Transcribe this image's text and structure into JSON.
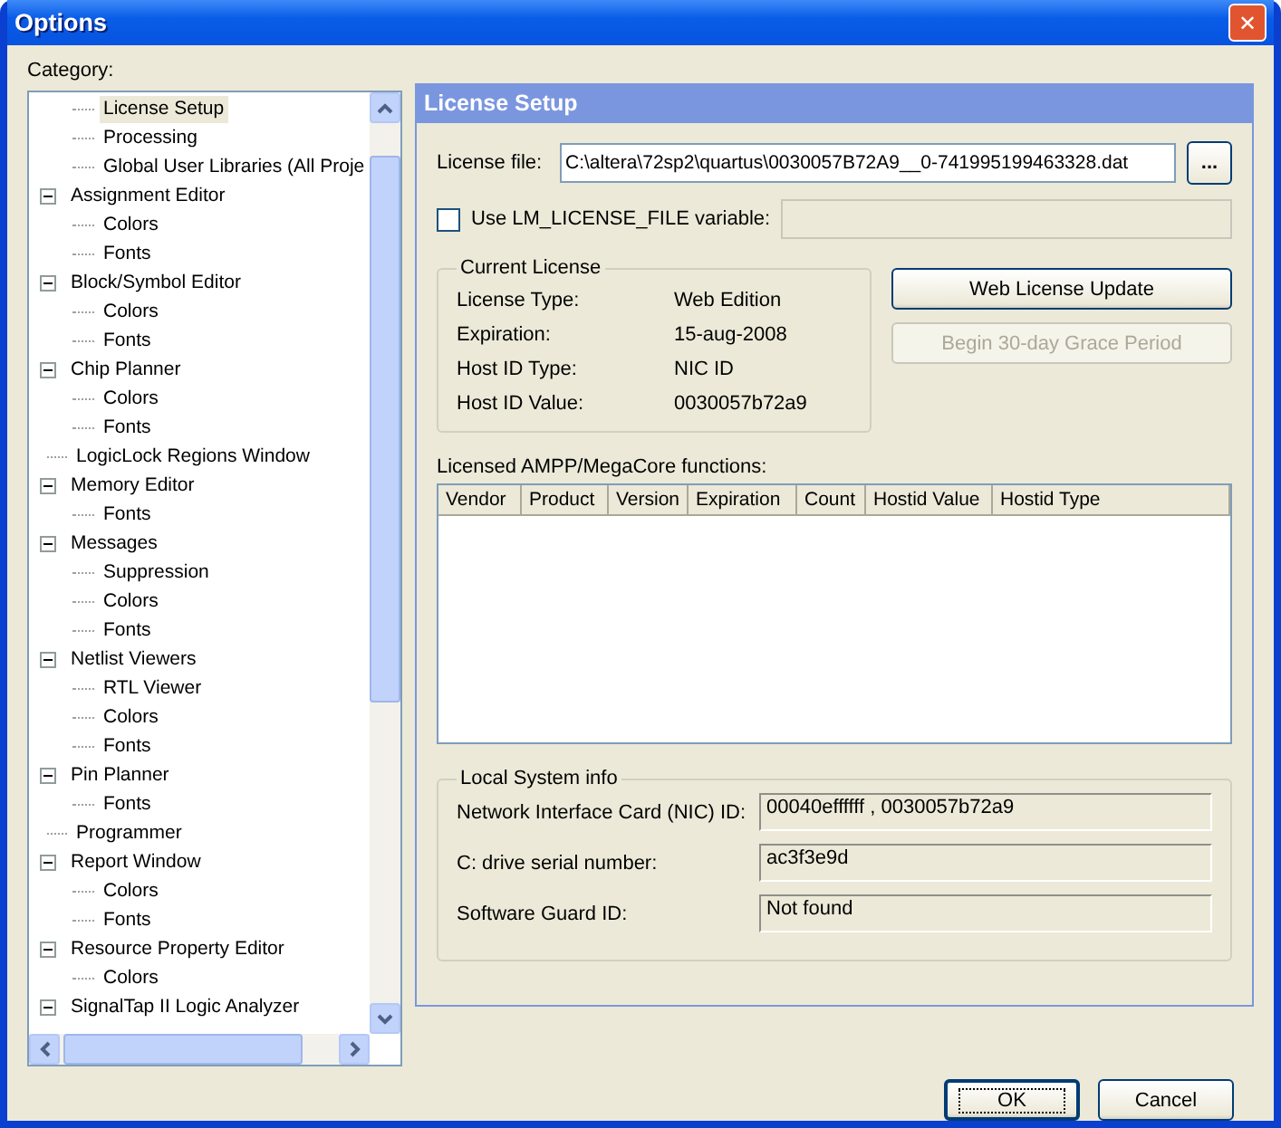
{
  "window": {
    "title": "Options",
    "close_label": "✕"
  },
  "category_label": "Category:",
  "tree": {
    "continued_children": [
      {
        "label": "License Setup",
        "selected": true
      },
      {
        "label": "Processing",
        "selected": false
      },
      {
        "label": "Global User Libraries (All Proje",
        "selected": false
      }
    ],
    "items": [
      {
        "label": "Assignment Editor",
        "selected": false,
        "expanded": true,
        "children": [
          {
            "label": "Colors",
            "selected": false
          },
          {
            "label": "Fonts",
            "selected": false
          }
        ]
      },
      {
        "label": "Block/Symbol Editor",
        "selected": false,
        "expanded": true,
        "children": [
          {
            "label": "Colors",
            "selected": false
          },
          {
            "label": "Fonts",
            "selected": false
          }
        ]
      },
      {
        "label": "Chip Planner",
        "selected": false,
        "expanded": true,
        "children": [
          {
            "label": "Colors",
            "selected": false
          },
          {
            "label": "Fonts",
            "selected": false
          }
        ]
      },
      {
        "label": "LogicLock Regions Window",
        "selected": false
      },
      {
        "label": "Memory Editor",
        "selected": false,
        "expanded": true,
        "children": [
          {
            "label": "Fonts",
            "selected": false
          }
        ]
      },
      {
        "label": "Messages",
        "selected": false,
        "expanded": true,
        "children": [
          {
            "label": "Suppression",
            "selected": false
          },
          {
            "label": "Colors",
            "selected": false
          },
          {
            "label": "Fonts",
            "selected": false
          }
        ]
      },
      {
        "label": "Netlist Viewers",
        "selected": false,
        "expanded": true,
        "children": [
          {
            "label": "RTL Viewer",
            "selected": false
          },
          {
            "label": "Colors",
            "selected": false
          },
          {
            "label": "Fonts",
            "selected": false
          }
        ]
      },
      {
        "label": "Pin Planner",
        "selected": false,
        "expanded": true,
        "children": [
          {
            "label": "Fonts",
            "selected": false
          }
        ]
      },
      {
        "label": "Programmer",
        "selected": false
      },
      {
        "label": "Report Window",
        "selected": false,
        "expanded": true,
        "children": [
          {
            "label": "Colors",
            "selected": false
          },
          {
            "label": "Fonts",
            "selected": false
          }
        ]
      },
      {
        "label": "Resource Property Editor",
        "selected": false,
        "expanded": true,
        "children": [
          {
            "label": "Colors",
            "selected": false
          }
        ]
      },
      {
        "label": "SignalTap II Logic Analyzer",
        "selected": false,
        "expanded": true
      }
    ]
  },
  "panel": {
    "title": "License Setup",
    "license_file": {
      "label": "License file:",
      "value": "C:\\altera\\72sp2\\quartus\\0030057B72A9__0-741995199463328.dat",
      "browse": "..."
    },
    "use_lm": {
      "label": "Use LM_LICENSE_FILE variable:",
      "checked": false
    },
    "current_license": {
      "title": "Current License",
      "rows": [
        {
          "label": "License Type:",
          "value": "Web Edition"
        },
        {
          "label": "Expiration:",
          "value": "15-aug-2008"
        },
        {
          "label": "Host ID Type:",
          "value": "NIC ID"
        },
        {
          "label": "Host ID Value:",
          "value": "0030057b72a9"
        }
      ]
    },
    "buttons": [
      {
        "label": "Web License Update",
        "disabled": false
      },
      {
        "label": "Begin 30-day Grace Period",
        "disabled": true
      }
    ],
    "table": {
      "title": "Licensed AMPP/MegaCore functions:",
      "columns": [
        "Vendor",
        "Product",
        "Version",
        "Expiration",
        "Count",
        "Hostid Value",
        "Hostid Type"
      ]
    },
    "local_system": {
      "title": "Local System info",
      "rows": [
        {
          "label": "Network Interface Card (NIC) ID:",
          "value": "00040effffff , 0030057b72a9"
        },
        {
          "label": "C: drive serial number:",
          "value": "ac3f3e9d"
        },
        {
          "label": "Software Guard ID:",
          "value": "Not found"
        }
      ]
    }
  },
  "footer_buttons": [
    {
      "label": "OK",
      "default": true
    },
    {
      "label": "Cancel",
      "default": false
    }
  ]
}
